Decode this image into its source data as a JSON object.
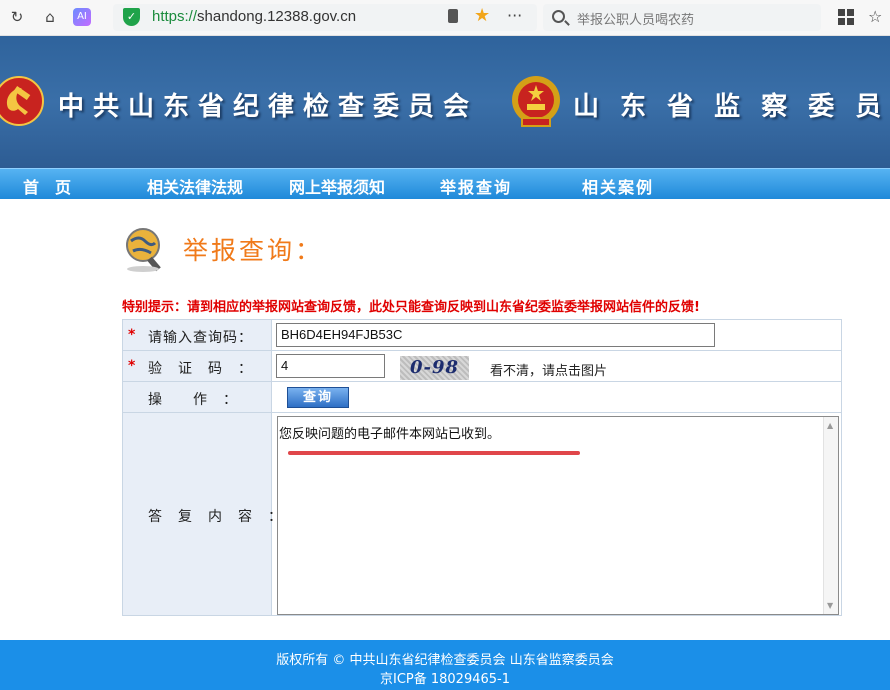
{
  "browser": {
    "url_scheme": "https://",
    "url_host": "shandong.12388.gov.cn",
    "search_placeholder": "举报公职人员喝农药"
  },
  "banner": {
    "left_title": "中共山东省纪律检查委员会",
    "right_title": "山 东 省 监 察 委 员"
  },
  "nav": {
    "items": [
      "首　页",
      "相关法律法规",
      "网上举报须知",
      "举报查询",
      "相关案例"
    ]
  },
  "section": {
    "title": "举报查询：",
    "tip": "特别提示：请到相应的举报网站查询反馈，此处只能查询反映到山东省纪委监委举报网站信件的反馈!"
  },
  "form": {
    "query_code_label": "请输入查询码：",
    "query_code_value": "BH6D4EH94FJB53C",
    "verify_label": "验　证　码　：",
    "verify_value": "4",
    "captcha_text": "0-98",
    "captcha_hint": "看不清，请点击图片",
    "action_label": "操　　作　：",
    "query_button": "查询",
    "reply_label": "答　复　内　容　：",
    "reply_text": "您反映问题的电子邮件本网站已收到。"
  },
  "footer": {
    "copyright": "版权所有 © 中共山东省纪律检查委员会 山东省监察委员会",
    "icp": "京ICP备 18029465-1"
  },
  "colors": {
    "banner_blue": "#3a6fa8",
    "nav_blue": "#1f89d9",
    "title_orange": "#f07a1a",
    "tip_red": "#e00000",
    "footer_blue": "#1b8fe8"
  }
}
